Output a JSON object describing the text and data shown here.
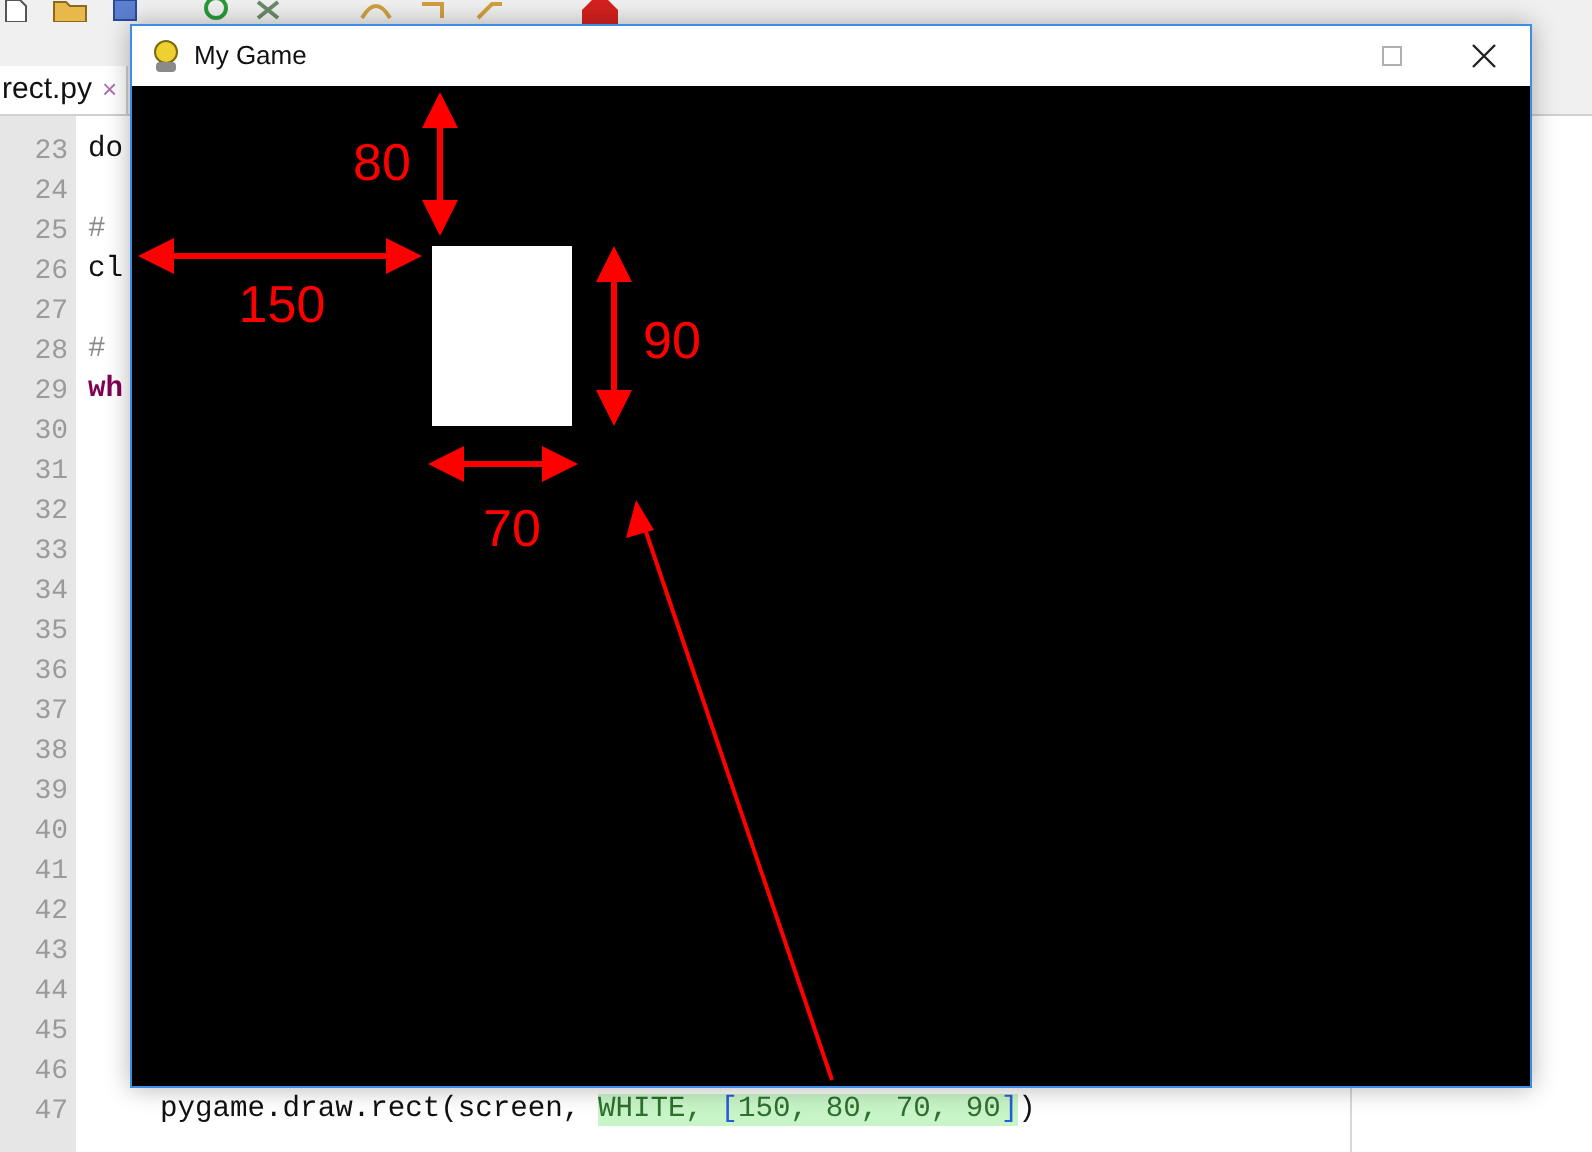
{
  "editor_tab": {
    "label": "rect.py",
    "close": "×",
    "selected": true
  },
  "editor": {
    "lines": [
      {
        "number": "23",
        "segments": [
          {
            "kind": "plain",
            "text": "do"
          }
        ]
      },
      {
        "number": "24"
      },
      {
        "number": "25",
        "segments": [
          {
            "kind": "comment",
            "text": "#"
          }
        ]
      },
      {
        "number": "26",
        "segments": [
          {
            "kind": "plain",
            "text": "cl"
          }
        ]
      },
      {
        "number": "27"
      },
      {
        "number": "28",
        "segments": [
          {
            "kind": "comment",
            "text": "#"
          }
        ]
      },
      {
        "number": "29",
        "segments": [
          {
            "kind": "keyword",
            "text": "wh"
          }
        ]
      },
      {
        "number": "30"
      },
      {
        "number": "31"
      },
      {
        "number": "32"
      },
      {
        "number": "33"
      },
      {
        "number": "34"
      },
      {
        "number": "35"
      },
      {
        "number": "36"
      },
      {
        "number": "37"
      },
      {
        "number": "38"
      },
      {
        "number": "39"
      },
      {
        "number": "40"
      },
      {
        "number": "41"
      },
      {
        "number": "42"
      },
      {
        "number": "43"
      },
      {
        "number": "44"
      },
      {
        "number": "45"
      },
      {
        "number": "46"
      },
      {
        "number": "47",
        "indent": true,
        "segments": [
          {
            "kind": "plain",
            "text": "pygame.draw.rect(screen, "
          },
          {
            "kind": "highlight",
            "text": "WHITE, "
          },
          {
            "kind": "highlight_bracket",
            "text": "["
          },
          {
            "kind": "highlight",
            "text": "150, 80, 70, 90"
          },
          {
            "kind": "highlight_bracket",
            "text": "]"
          },
          {
            "kind": "plain",
            "text": ")"
          }
        ]
      }
    ]
  },
  "game_window": {
    "title": "My Game",
    "annotations": [
      {
        "kind": "vertical",
        "text": "80"
      },
      {
        "kind": "horizontal",
        "text": "150"
      },
      {
        "kind": "vertical",
        "text": "90"
      },
      {
        "kind": "horizontal",
        "text": "70"
      }
    ]
  }
}
